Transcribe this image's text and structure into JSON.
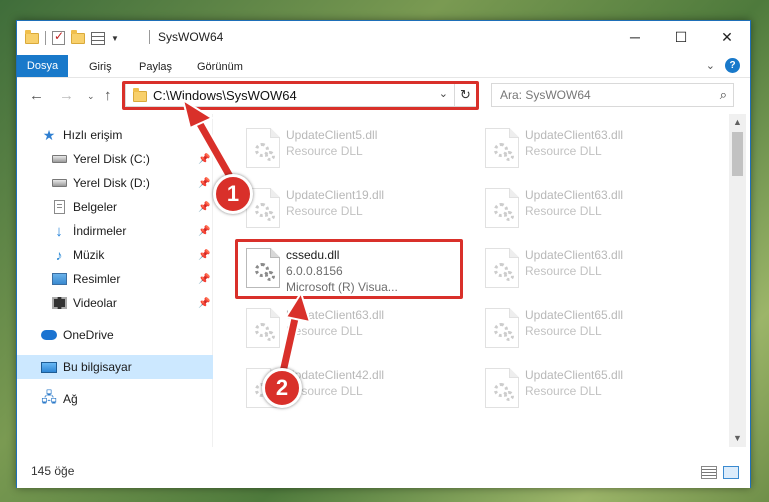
{
  "window": {
    "title": "SysWOW64"
  },
  "ribbon": {
    "tabs": [
      "Dosya",
      "Giriş",
      "Paylaş",
      "Görünüm"
    ],
    "help": "?"
  },
  "address": {
    "path": "C:\\Windows\\SysWOW64"
  },
  "search": {
    "placeholder": "Ara: SysWOW64"
  },
  "sidebar": {
    "items": [
      {
        "label": "Hızlı erişim"
      },
      {
        "label": "Yerel Disk (C:)"
      },
      {
        "label": "Yerel Disk (D:)"
      },
      {
        "label": "Belgeler"
      },
      {
        "label": "İndirmeler"
      },
      {
        "label": "Müzik"
      },
      {
        "label": "Resimler"
      },
      {
        "label": "Videolar"
      },
      {
        "label": "OneDrive"
      },
      {
        "label": "Bu bilgisayar"
      },
      {
        "label": "Ağ"
      }
    ]
  },
  "files": {
    "left": [
      {
        "name": "UpdateClient5.dll",
        "type": "Resource DLL"
      },
      {
        "name": "UpdateClient19.dll",
        "type": "Resource DLL"
      },
      {
        "name": "cssedu.dll",
        "version": "6.0.0.8156",
        "company": "Microsoft (R) Visua..."
      },
      {
        "name": "UpdateClient63.dll",
        "type": "Resource DLL"
      },
      {
        "name": "UpdateClient42.dll",
        "type": "Resource DLL"
      }
    ],
    "right": [
      {
        "name": "UpdateClient63.dll",
        "type": "Resource DLL"
      },
      {
        "name": "UpdateClient63.dll",
        "type": "Resource DLL"
      },
      {
        "name": "UpdateClient63.dll",
        "type": "Resource DLL"
      },
      {
        "name": "UpdateClient65.dll",
        "type": "Resource DLL"
      },
      {
        "name": "UpdateClient65.dll",
        "type": "Resource DLL"
      }
    ]
  },
  "status": {
    "count": "145 öğe"
  },
  "annotations": {
    "step1": "1",
    "step2": "2",
    "color": "#d9302a"
  }
}
